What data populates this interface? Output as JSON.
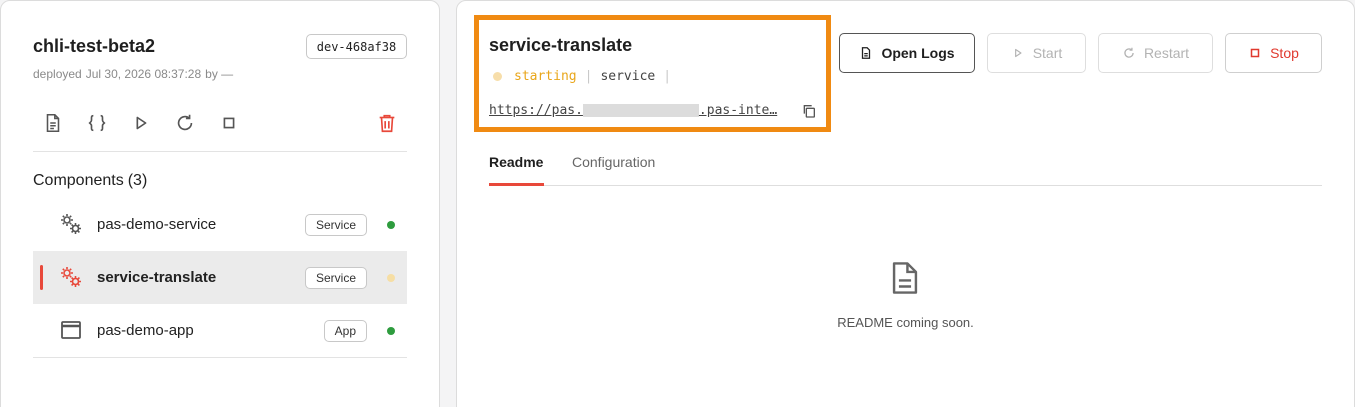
{
  "app": {
    "name": "chli-test-beta2",
    "env_badge": "dev-468af38",
    "deployed_label": "deployed",
    "deployed_time": "Jul 30, 2026 08:37:28",
    "deployed_by": "by —"
  },
  "components": {
    "heading": "Components",
    "count": "(3)",
    "items": [
      {
        "name": "pas-demo-service",
        "tag": "Service",
        "status_color": "#2e9c3e",
        "icon": "gears-icon"
      },
      {
        "name": "service-translate",
        "tag": "Service",
        "status_color": "#f6dea4",
        "icon": "gears-icon"
      },
      {
        "name": "pas-demo-app",
        "tag": "App",
        "status_color": "#2e9c3e",
        "icon": "window-icon"
      }
    ]
  },
  "service": {
    "name": "service-translate",
    "status": "starting",
    "kind": "service",
    "url_start": "https://pas.",
    "url_end": ".pas-inte…"
  },
  "buttons": {
    "open_logs": "Open Logs",
    "start": "Start",
    "restart": "Restart",
    "stop": "Stop"
  },
  "tabs": [
    {
      "label": "Readme",
      "active": true
    },
    {
      "label": "Configuration",
      "active": false
    }
  ],
  "readme": {
    "message": "README coming soon."
  },
  "colors": {
    "accent_red": "#e8483a",
    "highlight_orange": "#f08a12",
    "starting_yellow": "#e9a61a",
    "running_green": "#2e9c3e"
  }
}
